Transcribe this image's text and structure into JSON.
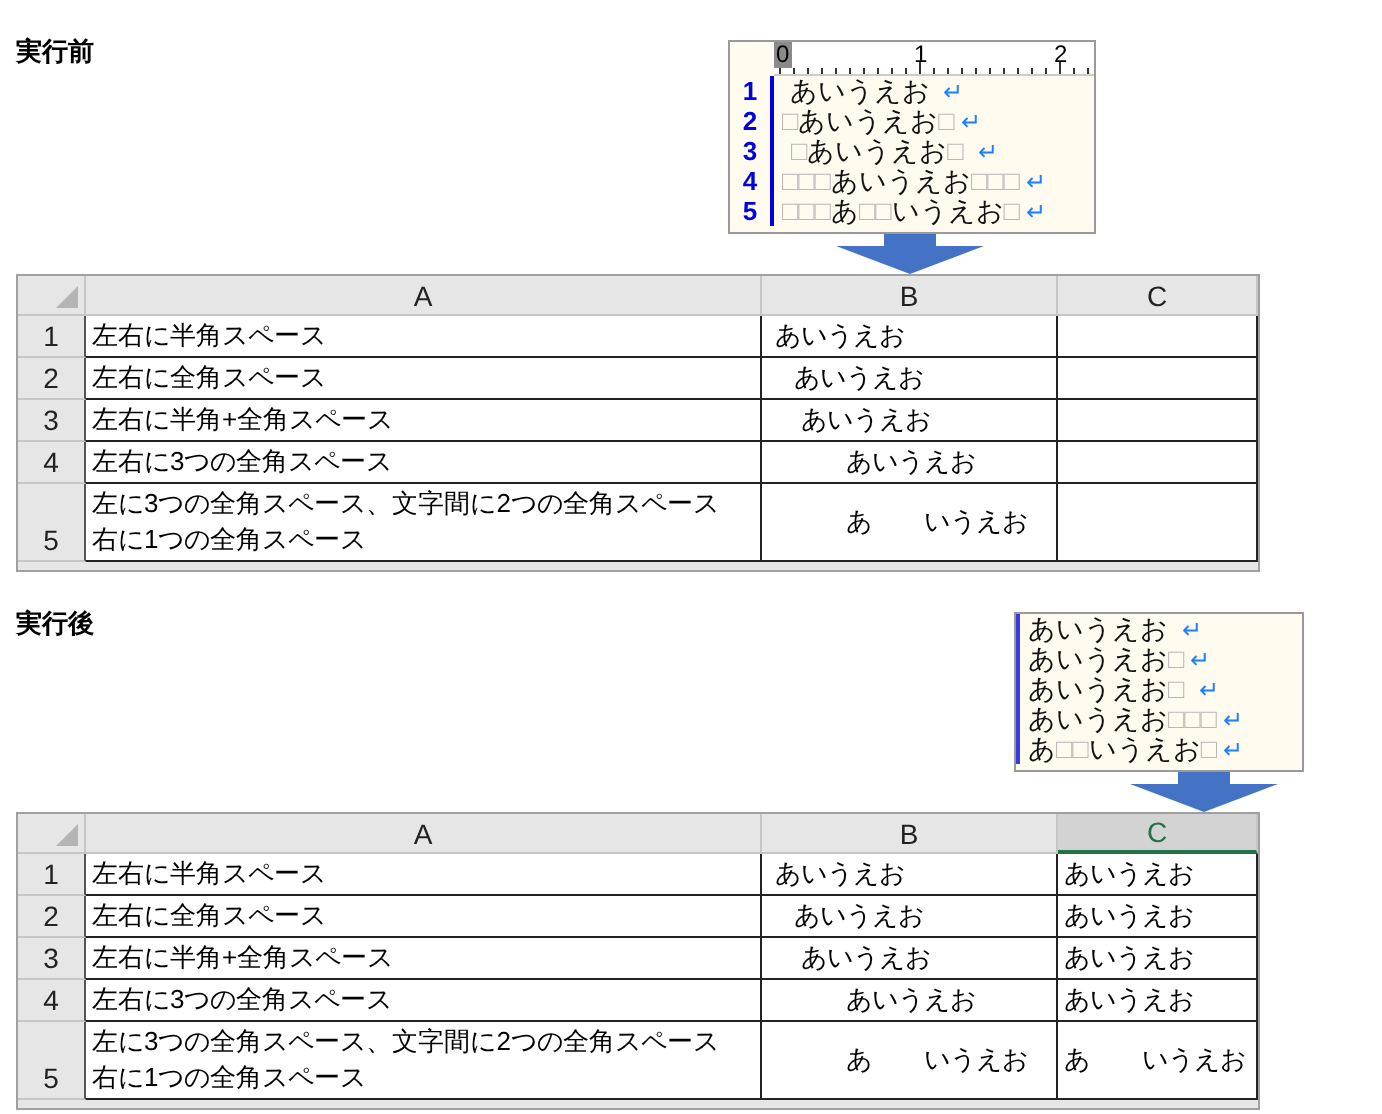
{
  "sections": [
    {
      "title": "実行前",
      "editor": {
        "ruler": [
          "0",
          "1",
          "2"
        ],
        "lines": [
          {
            "number": "1",
            "segments": [
              {
                "kind": "text",
                "text": " あいうえお "
              }
            ],
            "eol": "↵"
          },
          {
            "number": "2",
            "segments": [
              {
                "kind": "space",
                "text": "□"
              },
              {
                "kind": "text",
                "text": "あいうえお"
              },
              {
                "kind": "space",
                "text": "□"
              }
            ],
            "eol": "↵"
          },
          {
            "number": "3",
            "segments": [
              {
                "kind": "gap"
              },
              {
                "kind": "space",
                "text": "□"
              },
              {
                "kind": "text",
                "text": "あいうえお"
              },
              {
                "kind": "space",
                "text": "□"
              },
              {
                "kind": "gap"
              }
            ],
            "eol": "↵"
          },
          {
            "number": "4",
            "segments": [
              {
                "kind": "space",
                "text": "□□□"
              },
              {
                "kind": "text",
                "text": "あいうえお"
              },
              {
                "kind": "space",
                "text": "□□□"
              }
            ],
            "eol": "↵"
          },
          {
            "number": "5",
            "segments": [
              {
                "kind": "space",
                "text": "□□□"
              },
              {
                "kind": "text",
                "text": "あ"
              },
              {
                "kind": "space",
                "text": "□□"
              },
              {
                "kind": "text",
                "text": "いうえお"
              },
              {
                "kind": "space",
                "text": "□"
              }
            ],
            "eol": "↵"
          }
        ]
      },
      "sheet": {
        "columns": [
          {
            "label": "A",
            "selected": false
          },
          {
            "label": "B",
            "selected": false
          },
          {
            "label": "C",
            "selected": false
          }
        ],
        "rows": [
          {
            "number": "1",
            "cells": [
              "左右に半角スペース",
              " あいうえお "
            ]
          },
          {
            "number": "2",
            "cells": [
              "左右に全角スペース",
              "　あいうえお　"
            ]
          },
          {
            "number": "3",
            "cells": [
              "左右に半角+全角スペース",
              " 　あいうえお　 "
            ]
          },
          {
            "number": "4",
            "cells": [
              "左右に3つの全角スペース",
              "　　　あいうえお　　　"
            ]
          },
          {
            "number": "5",
            "cells": [
              [
                "左に3つの全角スペース、文字間に2つの全角スペース",
                "右に1つの全角スペース"
              ],
              "　　　あ　　いうえお　"
            ]
          }
        ]
      }
    },
    {
      "title": "実行後",
      "editor": {
        "lines": [
          {
            "segments": [
              {
                "kind": "text",
                "text": "あいうえお "
              }
            ],
            "eol": "↵"
          },
          {
            "segments": [
              {
                "kind": "text",
                "text": "あいうえお"
              },
              {
                "kind": "space",
                "text": "□"
              }
            ],
            "eol": "↵"
          },
          {
            "segments": [
              {
                "kind": "text",
                "text": "あいうえお"
              },
              {
                "kind": "space",
                "text": "□"
              },
              {
                "kind": "gap"
              }
            ],
            "eol": "↵"
          },
          {
            "segments": [
              {
                "kind": "text",
                "text": "あいうえお"
              },
              {
                "kind": "space",
                "text": "□□□"
              }
            ],
            "eol": "↵"
          },
          {
            "segments": [
              {
                "kind": "text",
                "text": "あ"
              },
              {
                "kind": "space",
                "text": "□□"
              },
              {
                "kind": "text",
                "text": "いうえお"
              },
              {
                "kind": "space",
                "text": "□"
              }
            ],
            "eol": "↵"
          }
        ]
      },
      "sheet": {
        "columns": [
          {
            "label": "A",
            "selected": false
          },
          {
            "label": "B",
            "selected": false
          },
          {
            "label": "C",
            "selected": true
          }
        ],
        "rows": [
          {
            "number": "1",
            "cells": [
              "左右に半角スペース",
              " あいうえお ",
              "あいうえお"
            ]
          },
          {
            "number": "2",
            "cells": [
              "左右に全角スペース",
              "　あいうえお　",
              "あいうえお"
            ]
          },
          {
            "number": "3",
            "cells": [
              "左右に半角+全角スペース",
              " 　あいうえお　 ",
              "あいうえお"
            ]
          },
          {
            "number": "4",
            "cells": [
              "左右に3つの全角スペース",
              "　　　あいうえお　　　",
              "あいうえお"
            ]
          },
          {
            "number": "5",
            "cells": [
              [
                "左に3つの全角スペース、文字間に2つの全角スペース",
                "右に1つの全角スペース"
              ],
              "　　　あ　　いうえお　",
              "あ　　いうえお"
            ]
          }
        ]
      }
    }
  ]
}
